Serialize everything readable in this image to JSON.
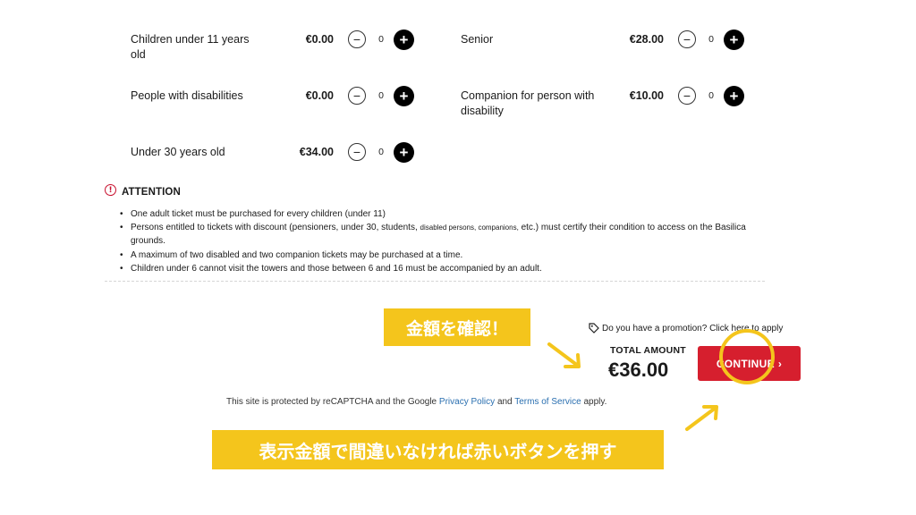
{
  "tickets": [
    {
      "label": "Children under 11 years old",
      "price": "€0.00",
      "qty": "0"
    },
    {
      "label": "Senior",
      "price": "€28.00",
      "qty": "0"
    },
    {
      "label": "People with disabilities",
      "price": "€0.00",
      "qty": "0"
    },
    {
      "label": "Companion for person with disability",
      "price": "€10.00",
      "qty": "0"
    },
    {
      "label": "Under 30 years old",
      "price": "€34.00",
      "qty": "0"
    }
  ],
  "buttons": {
    "minus": "−",
    "plus": "+"
  },
  "attention": {
    "icon_glyph": "!",
    "title": "ATTENTION",
    "notes": [
      "One adult ticket must be purchased for every children (under 11)",
      "Persons entitled to tickets with discount (pensioners, under 30, students,",
      "disabled persons, companions,",
      "etc.) must certify their condition to access on the Basilica grounds.",
      "A maximum of two disabled and two companion tickets may be purchased at a time.",
      "Children under 6 cannot visit the towers and those between 6 and 16 must be accompanied by an adult."
    ]
  },
  "annotations": {
    "check_amount": "金額を確認！",
    "instruction": "表示金額で間違いなければ赤いボタンを押す"
  },
  "promotion": {
    "text": "Do you have a promotion? Click here to apply"
  },
  "total": {
    "label": "TOTAL AMOUNT",
    "value": "€36.00"
  },
  "continue_button": {
    "label": "CONTINUE",
    "arrow": "›"
  },
  "recaptcha": {
    "prefix": "This site is protected by reCAPTCHA and the Google",
    "privacy": "Privacy Policy",
    "and": "and",
    "terms": "Terms of Service",
    "suffix": "apply."
  },
  "colors": {
    "accent_red": "#d61f2e",
    "annotation_yellow": "#f4c51c",
    "link_blue": "#2a6fb0"
  }
}
